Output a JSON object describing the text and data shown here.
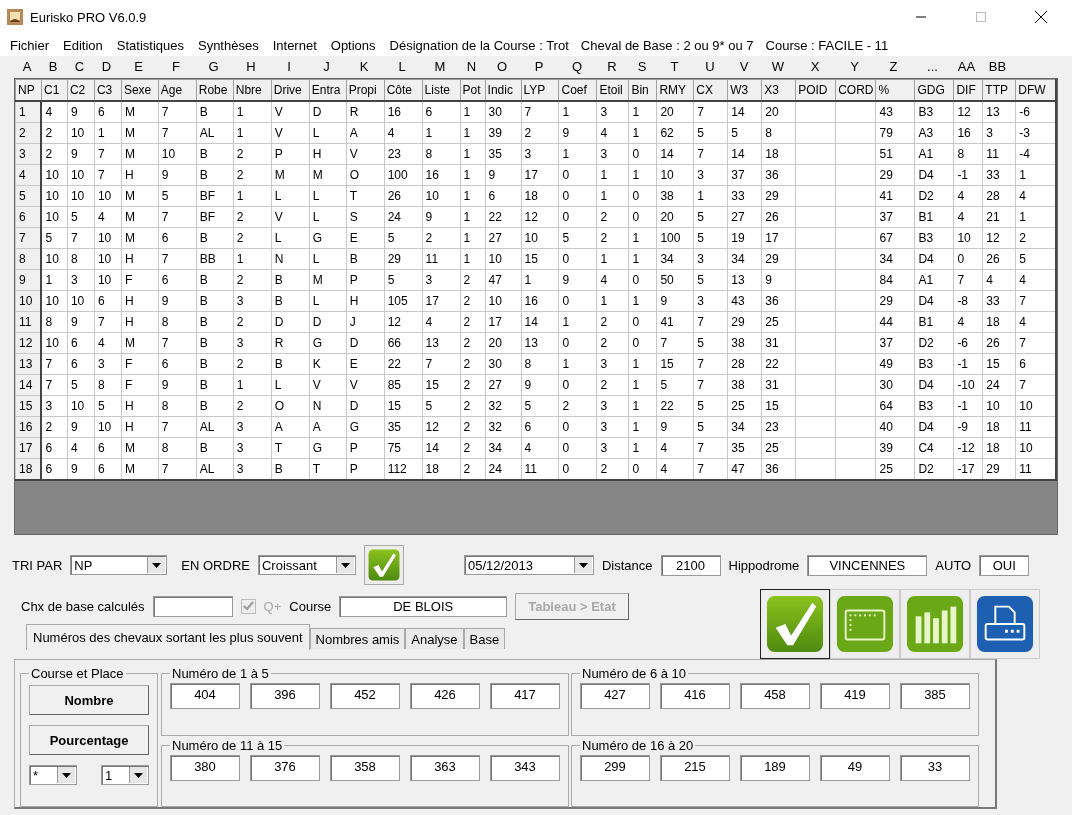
{
  "window": {
    "title": "Eurisko PRO V6.0.9"
  },
  "menu": [
    "Fichier",
    "Edition",
    "Statistiques",
    "Synthèses",
    "Internet",
    "Options"
  ],
  "course_info": [
    "Désignation de la Course : Trot",
    "Cheval de Base : 2 ou 9* ou 7",
    "Course : FACILE - 11"
  ],
  "column_letters": [
    "A",
    "B",
    "C",
    "D",
    "E",
    "F",
    "G",
    "H",
    "I",
    "J",
    "K",
    "L",
    "M",
    "N",
    "O",
    "P",
    "Q",
    "R",
    "S",
    "T",
    "U",
    "V",
    "W",
    "X",
    "Y",
    "Z",
    "...",
    "AA",
    "BB"
  ],
  "table": {
    "columns": [
      "NP",
      "C1",
      "C2",
      "C3",
      "Sexe",
      "Age",
      "Robe",
      "Nbre",
      "Drive",
      "Entra",
      "Propi",
      "Côte",
      "Liste",
      "Pot",
      "Indic",
      "LYP",
      "Coef",
      "Etoil",
      "Bin",
      "RMY",
      "CX",
      "W3",
      "X3",
      "POID",
      "CORD",
      "%",
      "GDG",
      "DIF",
      "TTP",
      "DFW"
    ],
    "rows": [
      [
        "1",
        "4",
        "9",
        "6",
        "M",
        "7",
        "B",
        "1",
        "V",
        "D",
        "R",
        "16",
        "6",
        "1",
        "30",
        "7",
        "1",
        "3",
        "1",
        "20",
        "7",
        "14",
        "20",
        null,
        null,
        "43",
        "B3",
        "12",
        "13",
        "-6"
      ],
      [
        "2",
        "2",
        "10",
        "1",
        "M",
        "7",
        "AL",
        "1",
        "V",
        "L",
        "A",
        "4",
        "1",
        "1",
        "39",
        "2",
        "9",
        "4",
        "1",
        "62",
        "5",
        "5",
        "8",
        null,
        null,
        "79",
        "A3",
        "16",
        "3",
        "-3"
      ],
      [
        "3",
        "2",
        "9",
        "7",
        "M",
        "10",
        "B",
        "2",
        "P",
        "H",
        "V",
        "23",
        "8",
        "1",
        "35",
        "3",
        "1",
        "3",
        "0",
        "14",
        "7",
        "14",
        "18",
        null,
        null,
        "51",
        "A1",
        "8",
        "11",
        "-4"
      ],
      [
        "4",
        "10",
        "10",
        "7",
        "H",
        "9",
        "B",
        "2",
        "M",
        "M",
        "O",
        "100",
        "16",
        "1",
        "9",
        "17",
        "0",
        "1",
        "1",
        "10",
        "3",
        "37",
        "36",
        null,
        null,
        "29",
        "D4",
        "-1",
        "33",
        "1"
      ],
      [
        "5",
        "10",
        "10",
        "10",
        "M",
        "5",
        "BF",
        "1",
        "L",
        "L",
        "T",
        "26",
        "10",
        "1",
        "6",
        "18",
        "0",
        "1",
        "0",
        "38",
        "1",
        "33",
        "29",
        null,
        null,
        "41",
        "D2",
        "4",
        "28",
        "4"
      ],
      [
        "6",
        "10",
        "5",
        "4",
        "M",
        "7",
        "BF",
        "2",
        "V",
        "L",
        "S",
        "24",
        "9",
        "1",
        "22",
        "12",
        "0",
        "2",
        "0",
        "20",
        "5",
        "27",
        "26",
        null,
        null,
        "37",
        "B1",
        "4",
        "21",
        "1"
      ],
      [
        "7",
        "5",
        "7",
        "10",
        "M",
        "6",
        "B",
        "2",
        "L",
        "G",
        "E",
        "5",
        "2",
        "1",
        "27",
        "10",
        "5",
        "2",
        "1",
        "100",
        "5",
        "19",
        "17",
        null,
        null,
        "67",
        "B3",
        "10",
        "12",
        "2"
      ],
      [
        "8",
        "10",
        "8",
        "10",
        "H",
        "7",
        "BB",
        "1",
        "N",
        "L",
        "B",
        "29",
        "11",
        "1",
        "10",
        "15",
        "0",
        "1",
        "1",
        "34",
        "3",
        "34",
        "29",
        null,
        null,
        "34",
        "D4",
        "0",
        "26",
        "5"
      ],
      [
        "9",
        "1",
        "3",
        "10",
        "F",
        "6",
        "B",
        "2",
        "B",
        "M",
        "P",
        "5",
        "3",
        "2",
        "47",
        "1",
        "9",
        "4",
        "0",
        "50",
        "5",
        "13",
        "9",
        null,
        null,
        "84",
        "A1",
        "7",
        "4",
        "4"
      ],
      [
        "10",
        "10",
        "10",
        "6",
        "H",
        "9",
        "B",
        "3",
        "B",
        "L",
        "H",
        "105",
        "17",
        "2",
        "10",
        "16",
        "0",
        "1",
        "1",
        "9",
        "3",
        "43",
        "36",
        null,
        null,
        "29",
        "D4",
        "-8",
        "33",
        "7"
      ],
      [
        "11",
        "8",
        "9",
        "7",
        "H",
        "8",
        "B",
        "2",
        "D",
        "D",
        "J",
        "12",
        "4",
        "2",
        "17",
        "14",
        "1",
        "2",
        "0",
        "41",
        "7",
        "29",
        "25",
        null,
        null,
        "44",
        "B1",
        "4",
        "18",
        "4"
      ],
      [
        "12",
        "10",
        "6",
        "4",
        "M",
        "7",
        "B",
        "3",
        "R",
        "G",
        "D",
        "66",
        "13",
        "2",
        "20",
        "13",
        "0",
        "2",
        "0",
        "7",
        "5",
        "38",
        "31",
        null,
        null,
        "37",
        "D2",
        "-6",
        "26",
        "7"
      ],
      [
        "13",
        "7",
        "6",
        "3",
        "F",
        "6",
        "B",
        "2",
        "B",
        "K",
        "E",
        "22",
        "7",
        "2",
        "30",
        "8",
        "1",
        "3",
        "1",
        "15",
        "7",
        "28",
        "22",
        null,
        null,
        "49",
        "B3",
        "-1",
        "15",
        "6"
      ],
      [
        "14",
        "7",
        "5",
        "8",
        "F",
        "9",
        "B",
        "1",
        "L",
        "V",
        "V",
        "85",
        "15",
        "2",
        "27",
        "9",
        "0",
        "2",
        "1",
        "5",
        "7",
        "38",
        "31",
        null,
        null,
        "30",
        "D4",
        "-10",
        "24",
        "7"
      ],
      [
        "15",
        "3",
        "10",
        "5",
        "H",
        "8",
        "B",
        "2",
        "O",
        "N",
        "D",
        "15",
        "5",
        "2",
        "32",
        "5",
        "2",
        "3",
        "1",
        "22",
        "5",
        "25",
        "15",
        null,
        null,
        "64",
        "B3",
        "-1",
        "10",
        "10"
      ],
      [
        "16",
        "2",
        "9",
        "10",
        "H",
        "7",
        "AL",
        "3",
        "A",
        "A",
        "G",
        "35",
        "12",
        "2",
        "32",
        "6",
        "0",
        "3",
        "1",
        "9",
        "5",
        "34",
        "23",
        null,
        null,
        "40",
        "D4",
        "-9",
        "18",
        "11"
      ],
      [
        "17",
        "6",
        "4",
        "6",
        "M",
        "8",
        "B",
        "3",
        "T",
        "G",
        "P",
        "75",
        "14",
        "2",
        "34",
        "4",
        "0",
        "3",
        "1",
        "4",
        "7",
        "35",
        "25",
        null,
        null,
        "39",
        "C4",
        "-12",
        "18",
        "10"
      ],
      [
        "18",
        "6",
        "9",
        "6",
        "M",
        "7",
        "AL",
        "3",
        "B",
        "T",
        "P",
        "112",
        "18",
        "2",
        "24",
        "11",
        "0",
        "2",
        "0",
        "4",
        "7",
        "47",
        "36",
        null,
        null,
        "25",
        "D2",
        "-17",
        "29",
        "11"
      ]
    ]
  },
  "controls": {
    "tri_par": {
      "label": "TRI PAR",
      "value": "NP"
    },
    "en_ordre": {
      "label": "EN ORDRE",
      "value": "Croissant"
    },
    "date": {
      "value": "05/12/2013"
    },
    "distance": {
      "label": "Distance",
      "value": "2100"
    },
    "hippodrome": {
      "label": "Hippodrome",
      "value": "VINCENNES"
    },
    "auto": {
      "label": "AUTO",
      "value": "OUI"
    },
    "chx_base": {
      "label": "Chx de base calculés"
    },
    "q_plus": {
      "label": "Q+",
      "checked": true,
      "disabled": true
    },
    "course": {
      "label": "Course",
      "value": "DE BLOIS"
    },
    "tableau_button": {
      "label": "Tableau > Etat",
      "disabled": true
    }
  },
  "tabs": [
    {
      "label": "Numéros des chevaux sortant les plus souvent",
      "selected": true
    },
    {
      "label": "Nombres amis",
      "selected": false
    },
    {
      "label": "Analyse",
      "selected": false
    },
    {
      "label": "Base",
      "selected": false
    }
  ],
  "course_et_place": {
    "title": "Course et Place",
    "buttons": [
      "Nombre",
      "Pourcentage"
    ],
    "selects": [
      "*",
      "1"
    ]
  },
  "groups": [
    {
      "title": "Numéro de 1 à 5",
      "values": [
        "404",
        "396",
        "452",
        "426",
        "417"
      ]
    },
    {
      "title": "Numéro de 6 à 10",
      "values": [
        "427",
        "416",
        "458",
        "419",
        "385"
      ]
    },
    {
      "title": "Numéro de 11 à 15",
      "values": [
        "380",
        "376",
        "358",
        "363",
        "343"
      ]
    },
    {
      "title": "Numéro de 16 à 20",
      "values": [
        "299",
        "215",
        "189",
        "49",
        "33"
      ]
    }
  ]
}
